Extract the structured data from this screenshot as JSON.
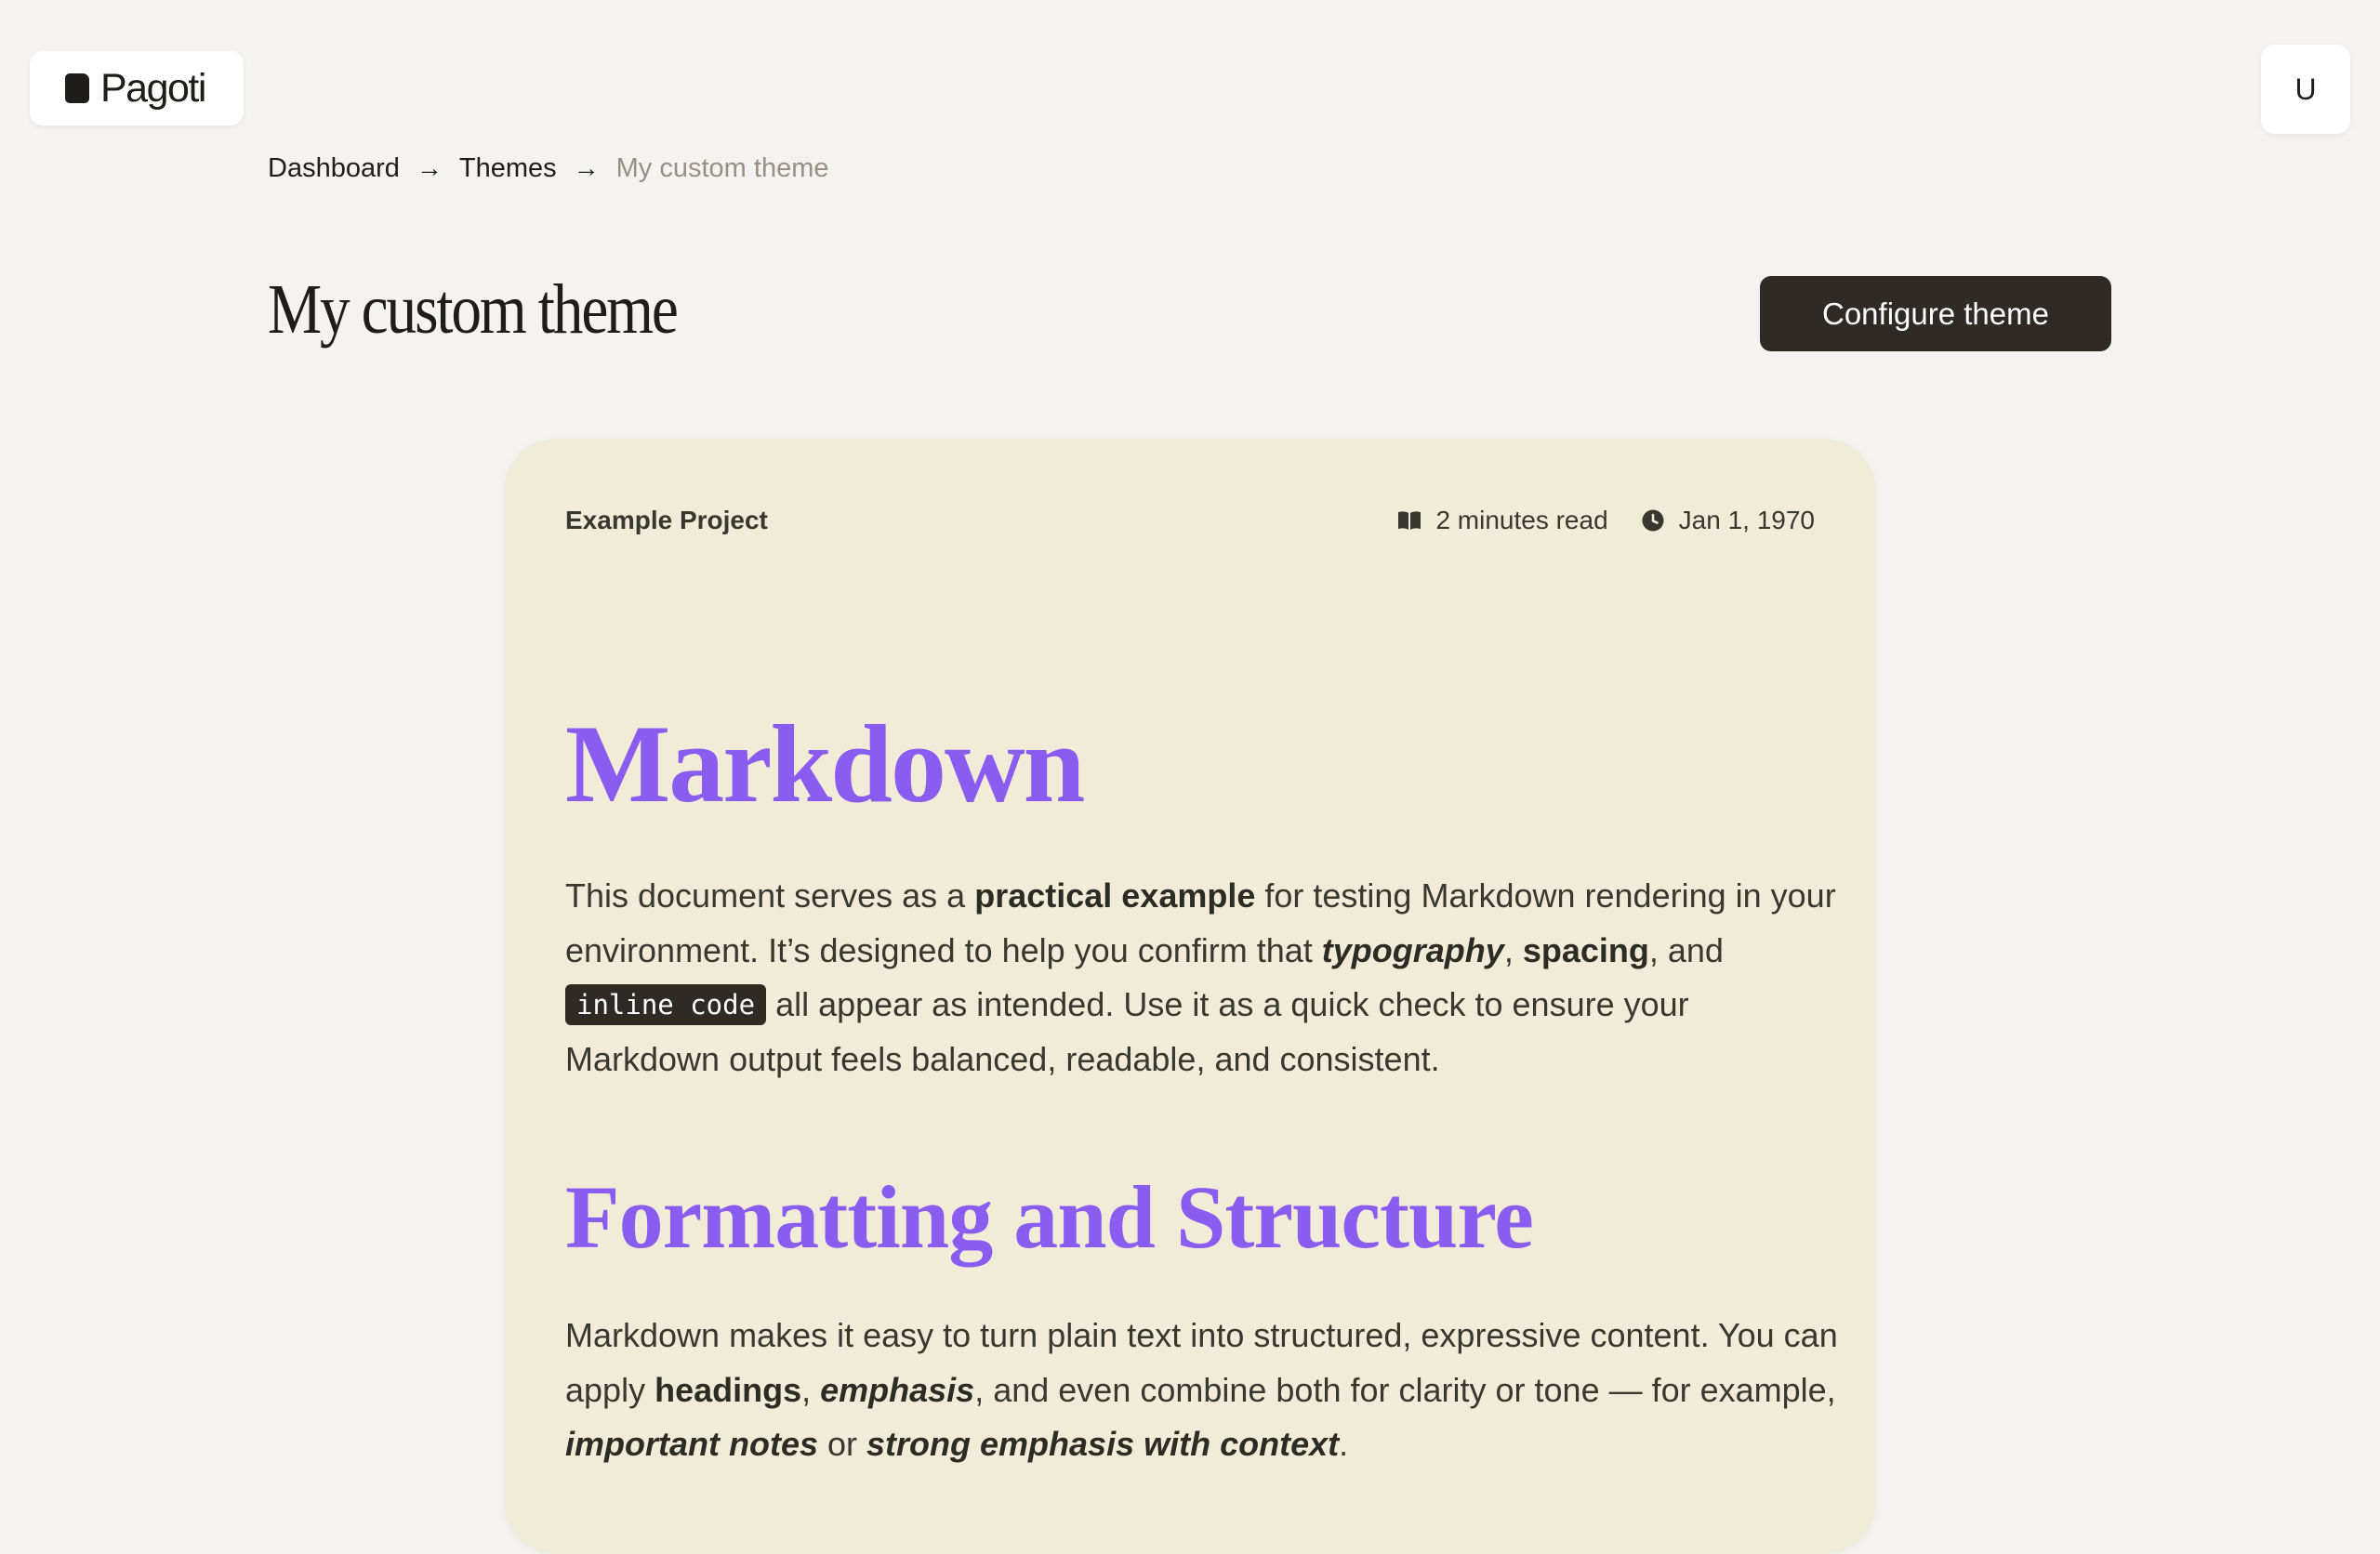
{
  "header": {
    "logo_text": "Pagoti",
    "user_initial": "U"
  },
  "breadcrumb": {
    "items": [
      "Dashboard",
      "Themes",
      "My custom theme"
    ],
    "separator": "→"
  },
  "page": {
    "title": "My custom theme",
    "configure_button": "Configure theme"
  },
  "preview": {
    "project_name": "Example Project",
    "read_time": "2 minutes read",
    "date": "Jan 1, 1970",
    "heading1": "Markdown",
    "p1": {
      "t1": "This document serves as a ",
      "b1": "practical example",
      "t2": " for testing Markdown rendering in your environment. It’s designed to help you confirm that ",
      "bi1": "typography",
      "t3": ", ",
      "b2": "spacing",
      "t4": ", and ",
      "code": "inline code",
      "t5": " all appear as intended. Use it as a quick check to ensure your Markdown output feels balanced, readable, and consistent."
    },
    "heading2": "Formatting and Structure",
    "p2": {
      "t1": "Markdown makes it easy to turn plain text into structured, expressive content. You can apply ",
      "b1": "headings",
      "t2": ", ",
      "bi1": "emphasis",
      "t3": ", and even combine both for clarity or tone — for example, ",
      "bi2": "important notes",
      "t4": " or ",
      "bi3": "strong emphasis with context",
      "t5": "."
    }
  },
  "colors": {
    "background": "#f4f3ef",
    "card_background": "#f1ecd7",
    "heading_accent": "#8b5cf0",
    "button_dark": "#2f2a24",
    "breadcrumb_current": "#9a8f83"
  },
  "icons": {
    "logo": "square-logo-icon",
    "read_time": "open-book-icon",
    "date": "clock-icon"
  }
}
